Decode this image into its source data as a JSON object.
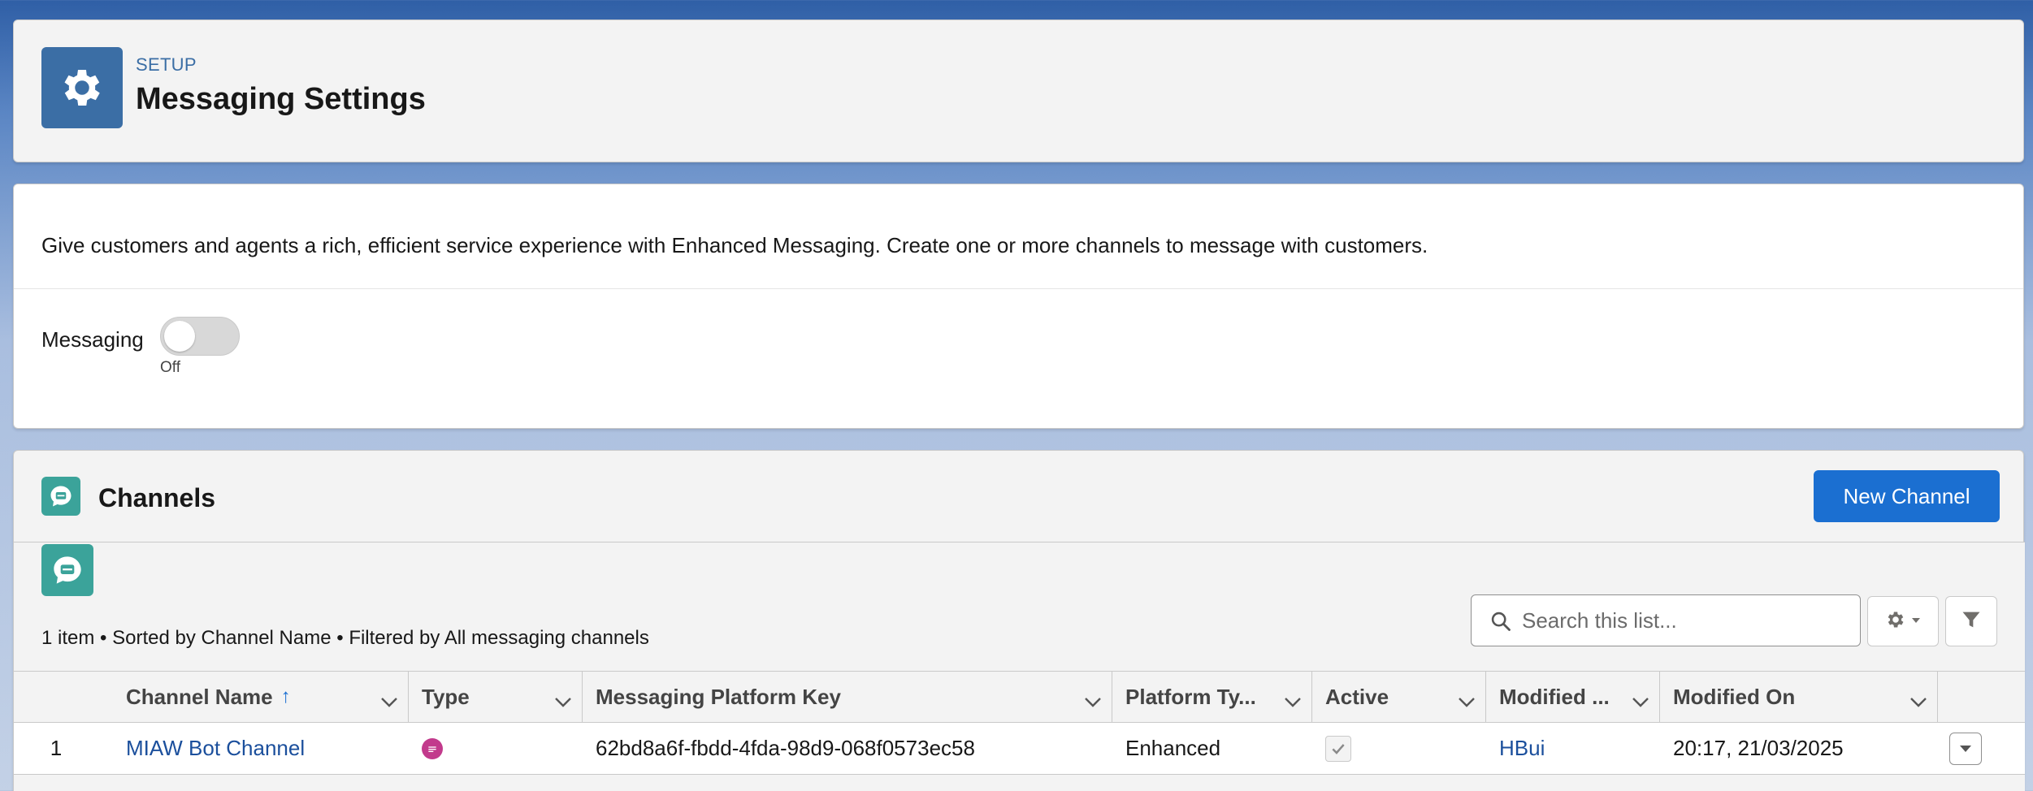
{
  "header": {
    "eyebrow": "SETUP",
    "title": "Messaging Settings",
    "icon": "gear-icon"
  },
  "intro": {
    "description": "Give customers and agents a rich, efficient service experience with Enhanced Messaging. Create one or more channels to message with customers.",
    "toggle_label": "Messaging",
    "toggle_state": "Off",
    "toggle_on": false
  },
  "channels": {
    "title": "Channels",
    "new_button": "New Channel",
    "meta": "1 item • Sorted by Channel Name • Filtered by All messaging channels",
    "search_placeholder": "Search this list...",
    "columns": [
      {
        "label": "Channel Name"
      },
      {
        "label": "Type"
      },
      {
        "label": "Messaging Platform Key"
      },
      {
        "label": "Platform Ty..."
      },
      {
        "label": "Active"
      },
      {
        "label": "Modified ..."
      },
      {
        "label": "Modified On"
      }
    ],
    "sort_indicator": "↑",
    "rows": [
      {
        "num": "1",
        "channel_name": "MIAW Bot Channel",
        "type_icon": "chat-bubble-icon",
        "platform_key": "62bd8a6f-fbdd-4fda-98d9-068f0573ec58",
        "platform_type": "Enhanced",
        "active": true,
        "modified_by": "HBui",
        "modified_on": "20:17, 21/03/2025"
      }
    ]
  },
  "colors": {
    "brand_blue": "#1b6fd1",
    "setup_icon_bg": "#3b6ea5",
    "channel_icon_bg": "#3ba39a",
    "type_icon_bg": "#c23a8c"
  }
}
